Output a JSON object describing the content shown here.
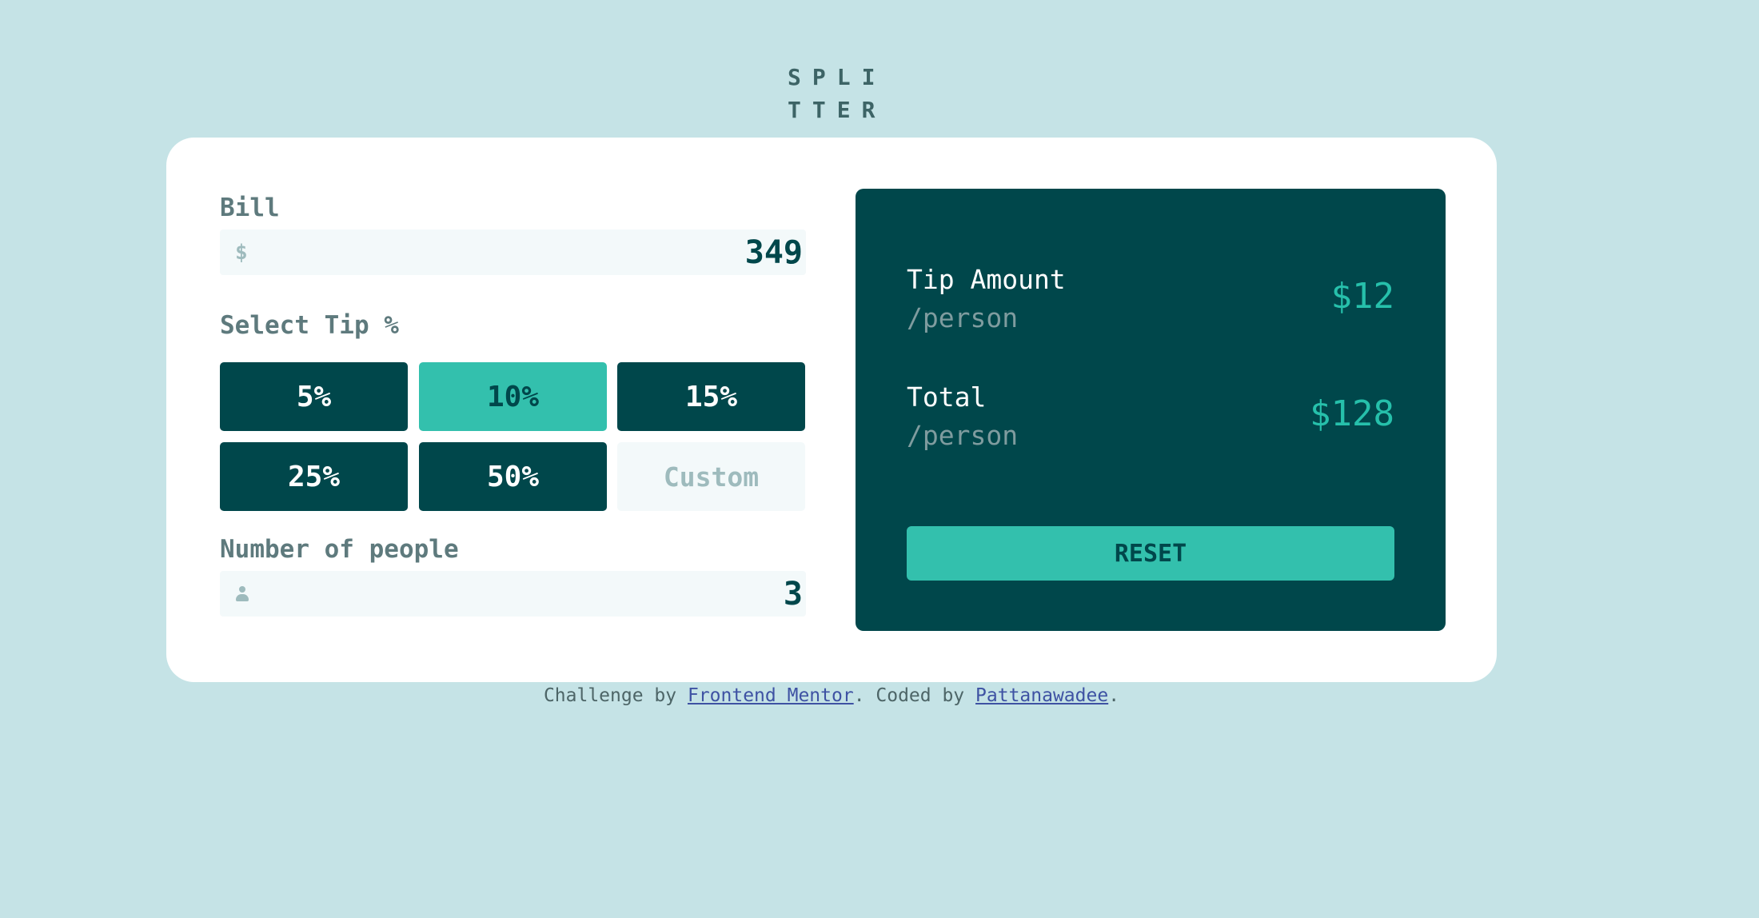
{
  "logo": {
    "line1": "SPLI",
    "line2": "TTER"
  },
  "bill": {
    "label": "Bill",
    "currency_icon": "dollar-sign-icon",
    "currency_symbol": "$",
    "value": "349"
  },
  "tip": {
    "label": "Select Tip %",
    "options": [
      "5%",
      "10%",
      "15%",
      "25%",
      "50%"
    ],
    "selected": "10%",
    "custom_placeholder": "Custom"
  },
  "people": {
    "label": "Number of people",
    "icon": "person-icon",
    "value": "3"
  },
  "results": {
    "tip_amount_label": "Tip Amount",
    "tip_amount_sub": "/person",
    "tip_amount_value": "$12",
    "total_label": "Total",
    "total_sub": "/person",
    "total_value": "$128",
    "reset_label": "RESET"
  },
  "footer": {
    "prefix": "Challenge by",
    "link1": "Frontend Mentor",
    "middle": ". Coded by",
    "link2": "Pattanawadee",
    "suffix": "."
  },
  "colors": {
    "background": "#c5e3e6",
    "dark_green": "#00474b",
    "accent": "#33c0ad",
    "input_bg": "#f3f9fa",
    "link": "#3e52a3"
  }
}
